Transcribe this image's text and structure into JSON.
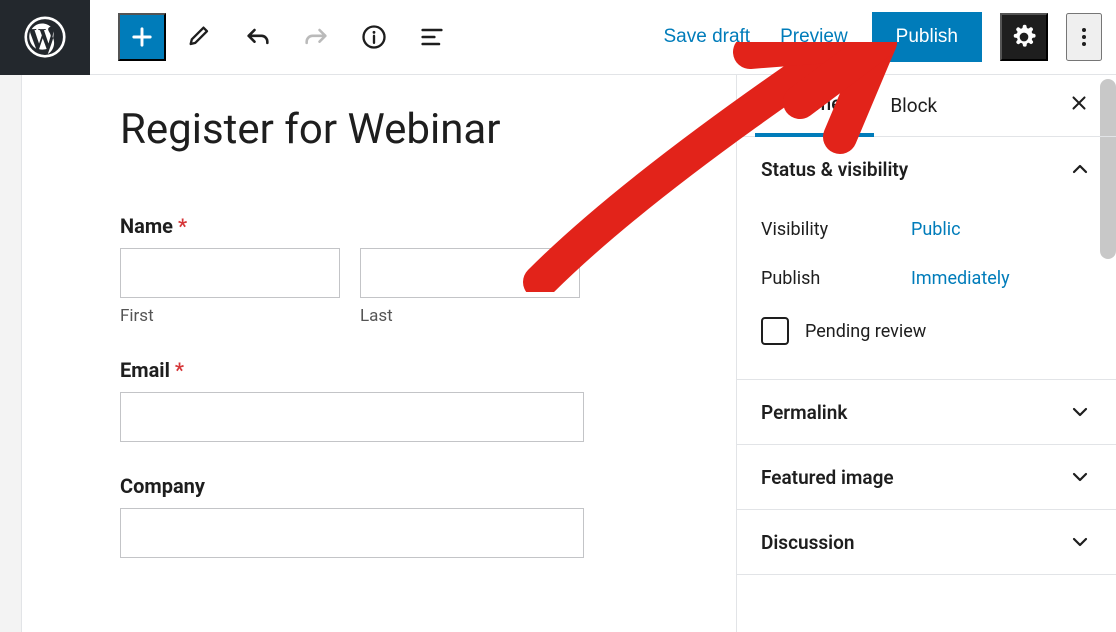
{
  "toolbar": {
    "save_draft": "Save draft",
    "preview": "Preview",
    "publish": "Publish"
  },
  "editor": {
    "title": "Register for Webinar",
    "fields": {
      "name_label": "Name",
      "name_first_sub": "First",
      "name_last_sub": "Last",
      "email_label": "Email",
      "company_label": "Company"
    }
  },
  "sidebar": {
    "tabs": {
      "document": "Document",
      "block": "Block"
    },
    "panels": {
      "status": {
        "title": "Status & visibility",
        "visibility_label": "Visibility",
        "visibility_value": "Public",
        "publish_label": "Publish",
        "publish_value": "Immediately",
        "pending_review": "Pending review"
      },
      "permalink": "Permalink",
      "featured_image": "Featured image",
      "discussion": "Discussion"
    }
  }
}
